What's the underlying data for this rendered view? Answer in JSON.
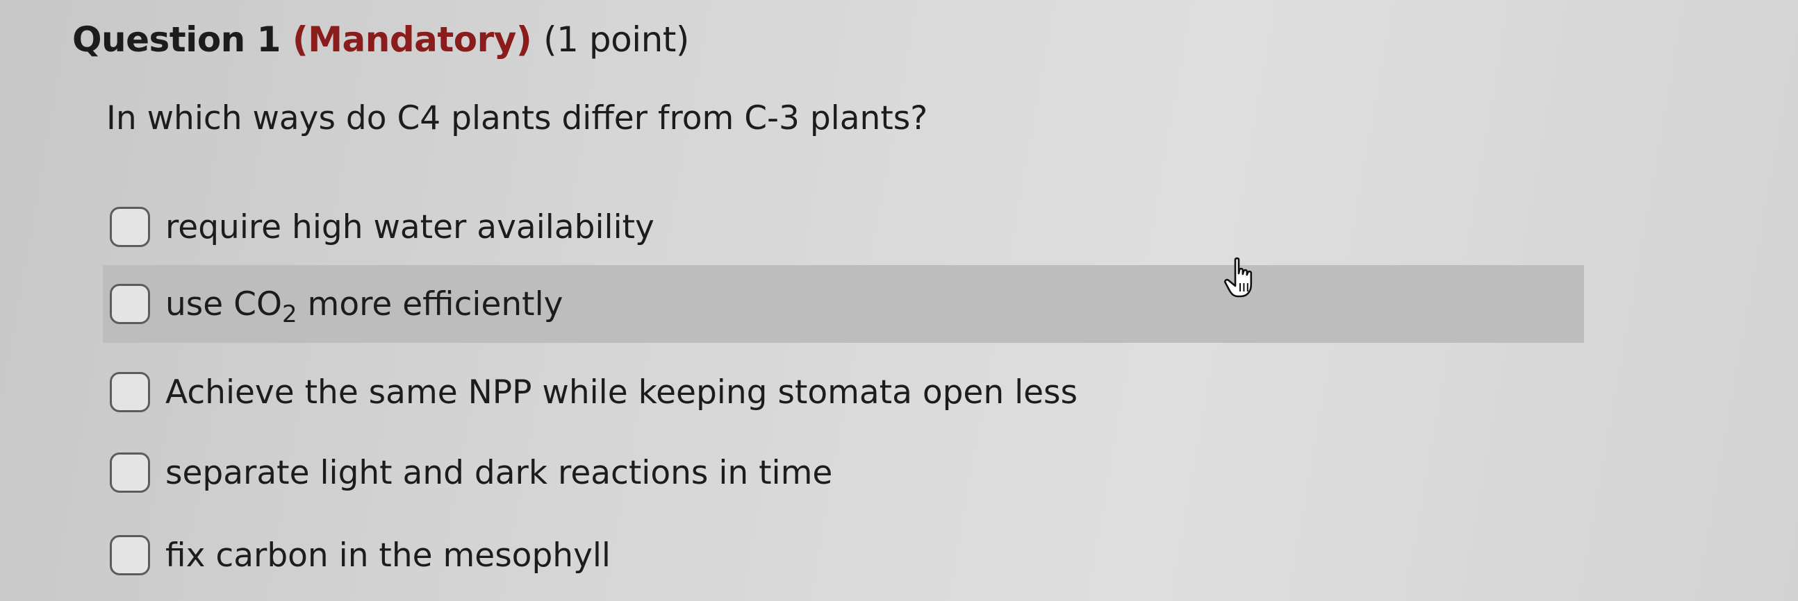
{
  "question": {
    "number_label": "Question 1",
    "mandatory_label": "(Mandatory)",
    "points_label": "(1 point)",
    "prompt": "In which ways do C4 plants differ from C-3 plants?"
  },
  "options": [
    {
      "label": "require high water availability",
      "checked": false,
      "highlighted": false
    },
    {
      "label_prefix": "use CO",
      "label_subscript": "2",
      "label_suffix": " more efficiently",
      "checked": false,
      "highlighted": true
    },
    {
      "label": "Achieve the same NPP while keeping stomata open less",
      "checked": false,
      "highlighted": false
    },
    {
      "label": "separate light and dark reactions in time",
      "checked": false,
      "highlighted": false
    },
    {
      "label": "fix carbon in the mesophyll",
      "checked": false,
      "highlighted": false
    }
  ],
  "colors": {
    "mandatory": "#8a1c1c",
    "highlight_row": "#bdbdbd",
    "text": "#1c1c1c"
  },
  "icons": {
    "cursor": "hand-pointer-icon"
  }
}
